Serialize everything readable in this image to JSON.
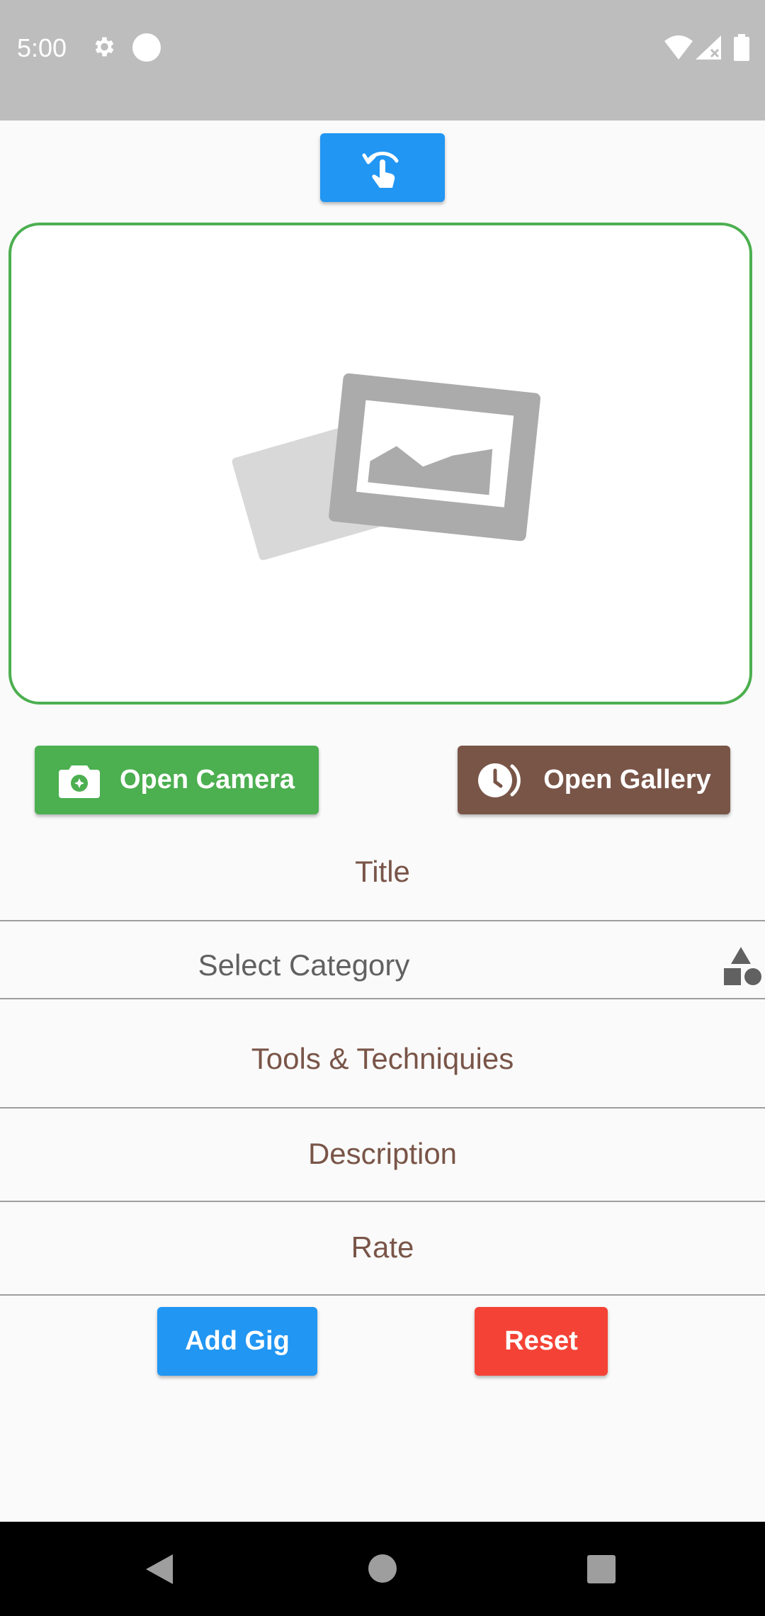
{
  "status_bar": {
    "time": "5:00",
    "icons": [
      "settings-icon",
      "circle-notification-icon",
      "wifi-icon",
      "signal-icon",
      "battery-icon"
    ]
  },
  "toolbar": {
    "rotate_icon": "touch-rotate-icon"
  },
  "image_preview": {
    "icon": "image-placeholder-icon"
  },
  "actions": {
    "camera_label": "Open Camera",
    "gallery_label": "Open Gallery"
  },
  "form": {
    "title_placeholder": "Title",
    "category_placeholder": "Select Category",
    "tools_placeholder": "Tools & Techniquies",
    "description_placeholder": "Description",
    "rate_placeholder": "Rate"
  },
  "buttons": {
    "add_label": "Add Gig",
    "reset_label": "Reset"
  },
  "colors": {
    "primary_blue": "#2196f3",
    "green": "#4caf50",
    "brown": "#795548",
    "red": "#f44336"
  }
}
